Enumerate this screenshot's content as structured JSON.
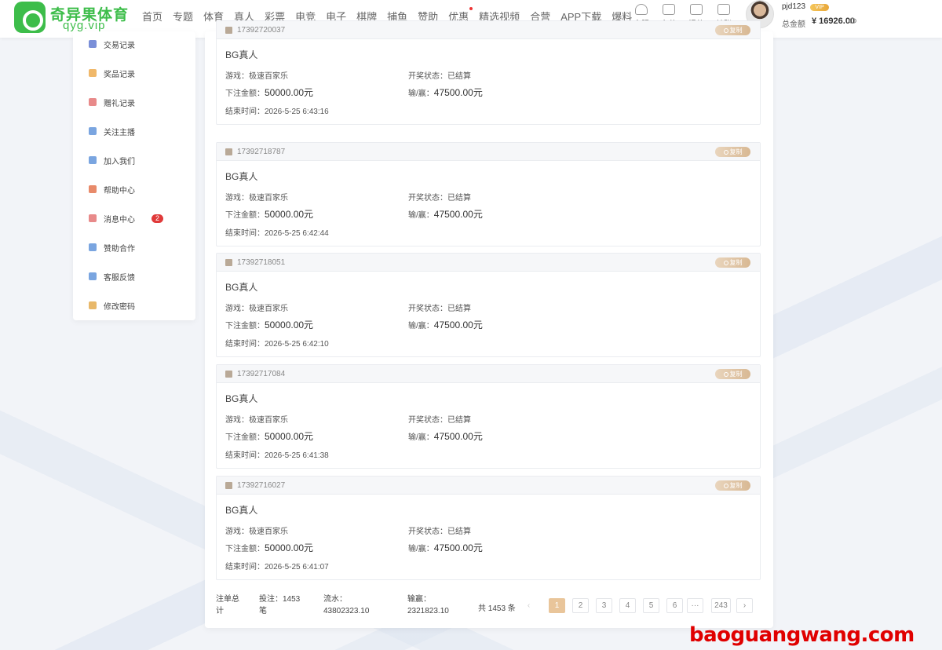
{
  "brand": {
    "name_cn": "奇异果体育",
    "domain": "qyg.vip",
    "color": "#3dbd4a"
  },
  "nav": [
    "首页",
    "专题",
    "体育",
    "真人",
    "彩票",
    "电竞",
    "电子",
    "棋牌",
    "捕鱼",
    "赞助",
    "优惠",
    "精选视频",
    "合营",
    "APP下载",
    "爆料"
  ],
  "quick_actions": [
    {
      "label": "客服",
      "icon": "headset-icon"
    },
    {
      "label": "存款",
      "icon": "wallet-icon"
    },
    {
      "label": "提款",
      "icon": "withdraw-icon"
    },
    {
      "label": "转账",
      "icon": "transfer-icon"
    }
  ],
  "user": {
    "name": "pjd123",
    "balance_label": "总金额",
    "balance": "¥ 16926.00"
  },
  "sidebar": [
    {
      "label": "交易记录",
      "icon": "transaction-icon",
      "color": "#7a8fd8"
    },
    {
      "label": "奖品记录",
      "icon": "gift-icon",
      "color": "#f0b86a"
    },
    {
      "label": "赠礼记录",
      "icon": "present-icon",
      "color": "#e88a8a"
    },
    {
      "label": "关注主播",
      "icon": "heart-icon",
      "color": "#7aa5e0"
    },
    {
      "label": "加入我们",
      "icon": "user-add-icon",
      "color": "#7aa5e0"
    },
    {
      "label": "帮助中心",
      "icon": "help-icon",
      "color": "#e88a6a"
    },
    {
      "label": "消息中心",
      "icon": "message-icon",
      "color": "#e88a8a",
      "badge": "2"
    },
    {
      "label": "赞助合作",
      "icon": "handshake-icon",
      "color": "#7aa5e0"
    },
    {
      "label": "客服反馈",
      "icon": "feedback-icon",
      "color": "#7aa5e0"
    },
    {
      "label": "修改密码",
      "icon": "lock-icon",
      "color": "#e8b86a"
    }
  ],
  "labels": {
    "game": "游戏：",
    "status": "开奖状态：",
    "bet": "下注金额：",
    "winloss": "输/赢：",
    "end_time": "结束时间：",
    "copy": "复制"
  },
  "records": [
    {
      "order": "17392720037",
      "platform": "BG真人",
      "game": "极速百家乐",
      "status": "已结算",
      "bet": "50000.00元",
      "winloss": "47500.00元",
      "end_time": "2026-5-25 6:43:16"
    },
    {
      "order": "17392718787",
      "platform": "BG真人",
      "game": "极速百家乐",
      "status": "已结算",
      "bet": "50000.00元",
      "winloss": "47500.00元",
      "end_time": "2026-5-25 6:42:44"
    },
    {
      "order": "17392718051",
      "platform": "BG真人",
      "game": "极速百家乐",
      "status": "已结算",
      "bet": "50000.00元",
      "winloss": "47500.00元",
      "end_time": "2026-5-25 6:42:10"
    },
    {
      "order": "17392717084",
      "platform": "BG真人",
      "game": "极速百家乐",
      "status": "已结算",
      "bet": "50000.00元",
      "winloss": "47500.00元",
      "end_time": "2026-5-25 6:41:38"
    },
    {
      "order": "17392716027",
      "platform": "BG真人",
      "game": "极速百家乐",
      "status": "已结算",
      "bet": "50000.00元",
      "winloss": "47500.00元",
      "end_time": "2026-5-25 6:41:07"
    }
  ],
  "summary": {
    "title_line1": "注单总",
    "title_line2": "计",
    "bets_line1": "投注：1453",
    "bets_line2": "笔",
    "flow_line1": "流水：",
    "flow_line2": "43802323.10",
    "winloss_line1": "输赢：",
    "winloss_line2": "2321823.10"
  },
  "pagination": {
    "total": "共 1453 条",
    "pages": [
      "1",
      "2",
      "3",
      "4",
      "5",
      "6"
    ],
    "ellipsis": "···",
    "last": "243",
    "current": "1"
  },
  "watermark": "baoguangwang.com"
}
